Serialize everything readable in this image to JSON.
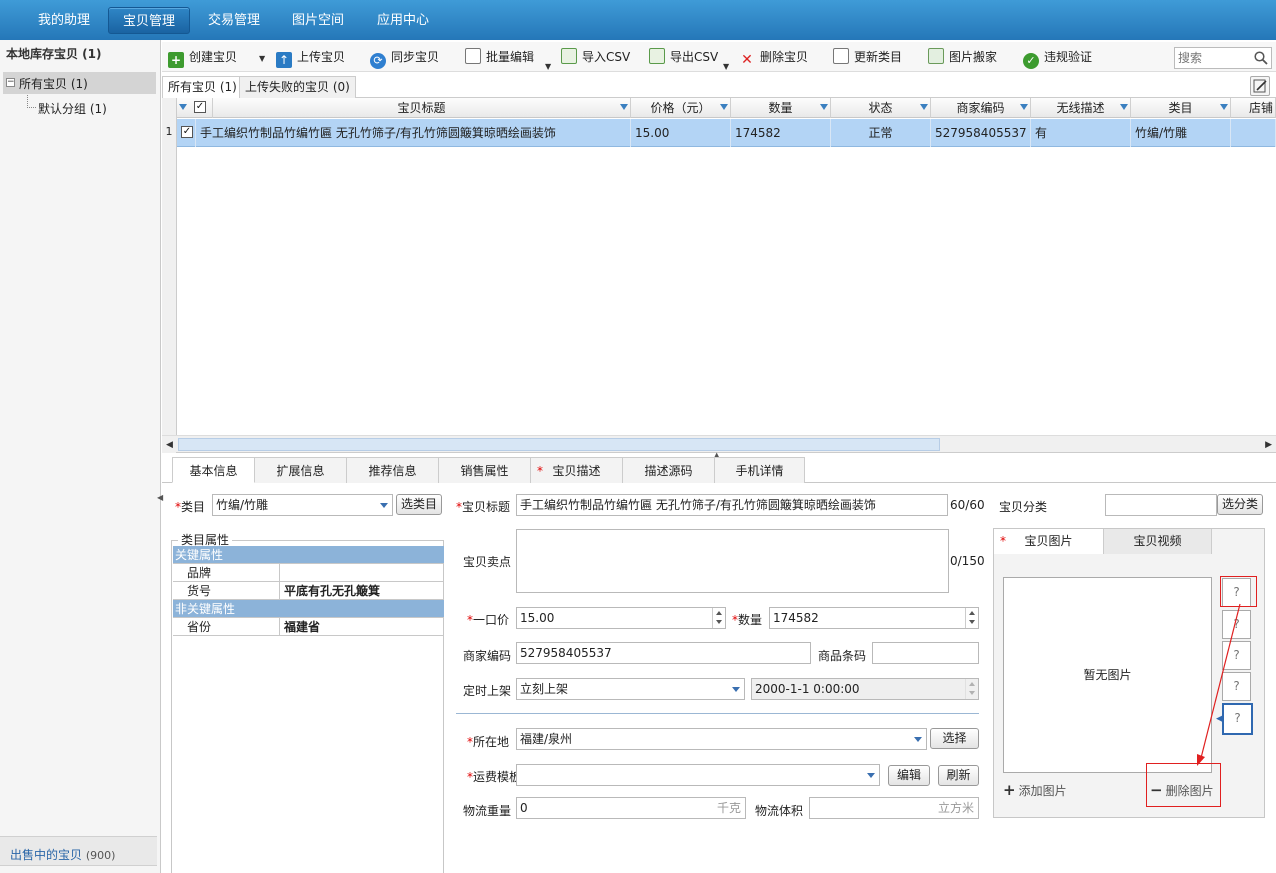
{
  "nav": [
    "我的助理",
    "宝贝管理",
    "交易管理",
    "图片空间",
    "应用中心"
  ],
  "sidebar": {
    "title": "本地库存宝贝 (1)",
    "root": "所有宝贝 (1)",
    "child": "默认分组 (1)",
    "bottom_label": "出售中的宝贝",
    "bottom_count": "(900)"
  },
  "toolbar": {
    "create": "创建宝贝",
    "upload": "上传宝贝",
    "sync": "同步宝贝",
    "batch_edit": "批量编辑",
    "import_csv": "导入CSV",
    "export_csv": "导出CSV",
    "delete": "删除宝贝",
    "update_category": "更新类目",
    "image_move": "图片搬家",
    "violation_check": "违规验证",
    "search_placeholder": "搜索"
  },
  "list_tabs": [
    "所有宝贝 (1)",
    "上传失败的宝贝 (0)"
  ],
  "grid": {
    "headers": [
      "宝贝标题",
      "价格（元）",
      "数量",
      "状态",
      "商家编码",
      "无线描述",
      "类目",
      "店铺"
    ],
    "rows": [
      {
        "num": "1",
        "title": "手工编织竹制品竹编竹匾 无孔竹筛子/有孔竹筛圆簸箕晾晒绘画装饰",
        "price": "15.00",
        "qty": "174582",
        "status": "正常",
        "code": "527958405537",
        "wireless": "有",
        "category": "竹编/竹雕"
      }
    ]
  },
  "detail_tabs": [
    "基本信息",
    "扩展信息",
    "推荐信息",
    "销售属性",
    "宝贝描述",
    "描述源码",
    "手机详情"
  ],
  "form": {
    "category_label": "类目",
    "category_value": "竹编/竹雕",
    "select_category_btn": "选类目",
    "attr_title": "类目属性",
    "key_attrs": "关键属性",
    "brand_label": "品牌",
    "brand_value": "",
    "sku_label": "货号",
    "sku_value": "平底有孔无孔簸箕",
    "nonkey_attrs": "非关键属性",
    "province_label": "省份",
    "province_value": "福建省",
    "title_label": "宝贝标题",
    "title_value": "手工编织竹制品竹编竹匾 无孔竹筛子/有孔竹筛圆簸箕晾晒绘画装饰",
    "title_count": "60/60",
    "selling_label": "宝贝卖点",
    "selling_value": "",
    "selling_count": "0/150",
    "price_label": "一口价",
    "price_value": "15.00",
    "qty_label": "数量",
    "qty_value": "174582",
    "code_label": "商家编码",
    "code_value": "527958405537",
    "barcode_label": "商品条码",
    "barcode_value": "",
    "schedule_label": "定时上架",
    "schedule_value": "立刻上架",
    "schedule_time": "2000-1-1 0:00:00",
    "location_label": "所在地",
    "location_value": "福建/泉州",
    "select_btn": "选择",
    "shipping_label": "运费模板",
    "shipping_value": "",
    "edit_btn": "编辑",
    "refresh_btn": "刷新",
    "weight_label": "物流重量",
    "weight_value": "0",
    "weight_unit": "千克",
    "volume_label": "物流体积",
    "volume_value": "",
    "volume_unit": "立方米",
    "shop_cat_label": "宝贝分类",
    "shop_cat_value": "",
    "select_cat_btn": "选分类"
  },
  "images": {
    "tab_images": "宝贝图片",
    "tab_video": "宝贝视频",
    "no_image": "暂无图片",
    "thumb": "?",
    "add": "添加图片",
    "remove": "删除图片"
  },
  "colors": {
    "accent": "#2577b8",
    "selected_row": "#b3d4f5",
    "required": "#e00000",
    "annotation": "#e02020"
  }
}
